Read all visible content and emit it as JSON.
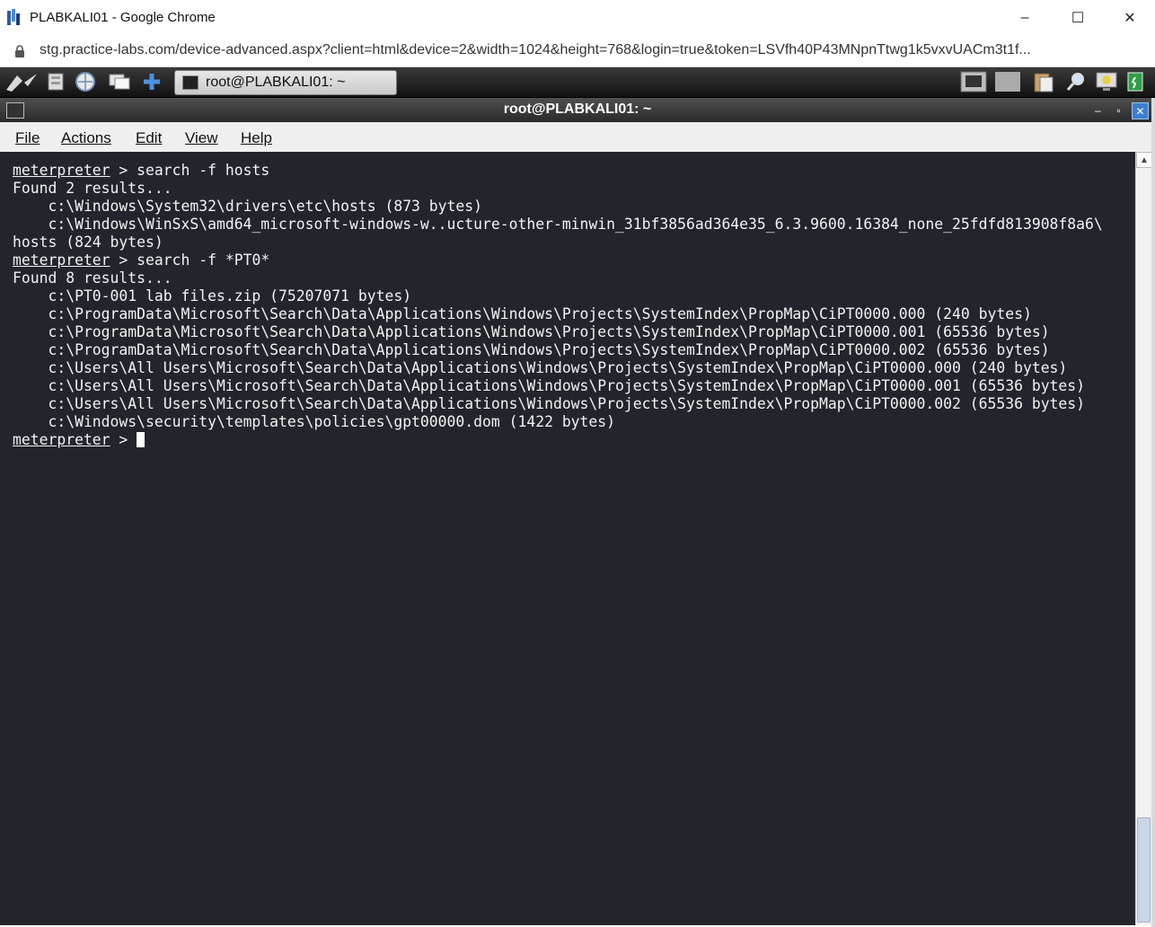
{
  "window": {
    "title": "PLABKALI01 - Google Chrome",
    "minimize": "–",
    "maximize": "☐",
    "close": "✕"
  },
  "address": {
    "url": "stg.practice-labs.com/device-advanced.aspx?client=html&device=2&width=1024&height=768&login=true&token=LSVfh40P43MNpnTtwg1k5vxvUACm3t1f..."
  },
  "panel": {
    "task_label": "root@PLABKALI01: ~"
  },
  "terminal_window": {
    "title": "root@PLABKALI01: ~",
    "menu": [
      "File",
      "Actions",
      "Edit",
      "View",
      "Help"
    ]
  },
  "terminal": {
    "prompt": "meterpreter",
    "lines": [
      " > search -f hosts",
      "Found 2 results...",
      "    c:\\Windows\\System32\\drivers\\etc\\hosts (873 bytes)",
      "    c:\\Windows\\WinSxS\\amd64_microsoft-windows-w..ucture-other-minwin_31bf3856ad364e35_6.3.9600.16384_none_25fdfd813908f8a6\\",
      "hosts (824 bytes)",
      " > search -f *PT0*",
      "Found 8 results...",
      "    c:\\PT0-001 lab files.zip (75207071 bytes)",
      "    c:\\ProgramData\\Microsoft\\Search\\Data\\Applications\\Windows\\Projects\\SystemIndex\\PropMap\\CiPT0000.000 (240 bytes)",
      "    c:\\ProgramData\\Microsoft\\Search\\Data\\Applications\\Windows\\Projects\\SystemIndex\\PropMap\\CiPT0000.001 (65536 bytes)",
      "    c:\\ProgramData\\Microsoft\\Search\\Data\\Applications\\Windows\\Projects\\SystemIndex\\PropMap\\CiPT0000.002 (65536 bytes)",
      "    c:\\Users\\All Users\\Microsoft\\Search\\Data\\Applications\\Windows\\Projects\\SystemIndex\\PropMap\\CiPT0000.000 (240 bytes)",
      "    c:\\Users\\All Users\\Microsoft\\Search\\Data\\Applications\\Windows\\Projects\\SystemIndex\\PropMap\\CiPT0000.001 (65536 bytes)",
      "    c:\\Users\\All Users\\Microsoft\\Search\\Data\\Applications\\Windows\\Projects\\SystemIndex\\PropMap\\CiPT0000.002 (65536 bytes)",
      "    c:\\Windows\\security\\templates\\policies\\gpt00000.dom (1422 bytes)",
      " > "
    ]
  },
  "colors": {
    "terminal_bg": "#22252b",
    "terminal_fg": "#f2f2f2",
    "scroll_thumb": "#c9d6e6"
  }
}
